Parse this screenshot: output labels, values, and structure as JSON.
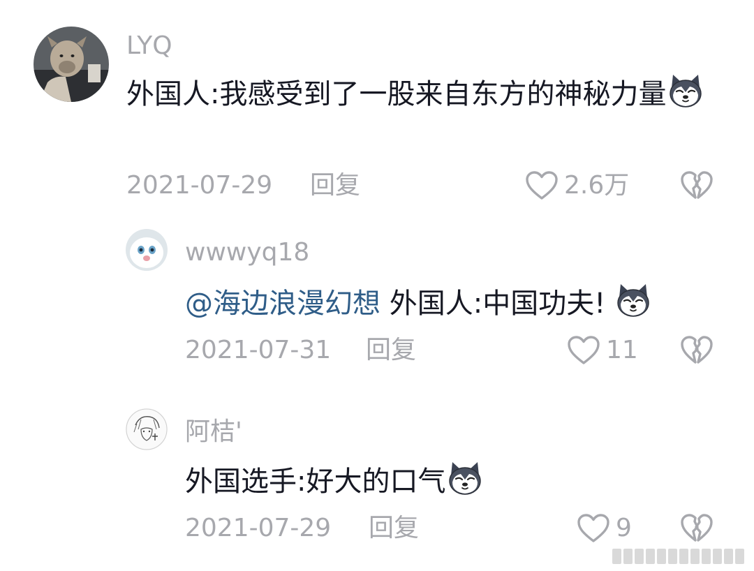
{
  "comments": [
    {
      "username": "LYQ",
      "text": "外国人:我感受到了一股来自东方的神秘力量",
      "emoji": "husky-doge-emoji",
      "date": "2021-07-29",
      "reply_label": "回复",
      "like_count": "2.6万"
    },
    {
      "username": "wwwyq18",
      "mention": "@海边浪漫幻想",
      "text": "外国人:中国功夫!",
      "emoji": "husky-doge-emoji",
      "date": "2021-07-31",
      "reply_label": "回复",
      "like_count": "11"
    },
    {
      "username": "阿桔'",
      "text": "外国选手:好大的口气",
      "emoji": "husky-doge-emoji",
      "date": "2021-07-29",
      "reply_label": "回复",
      "like_count": "9"
    }
  ],
  "colors": {
    "text": "#161823",
    "muted": "#a7a8ad",
    "mention": "#2f5d88"
  }
}
